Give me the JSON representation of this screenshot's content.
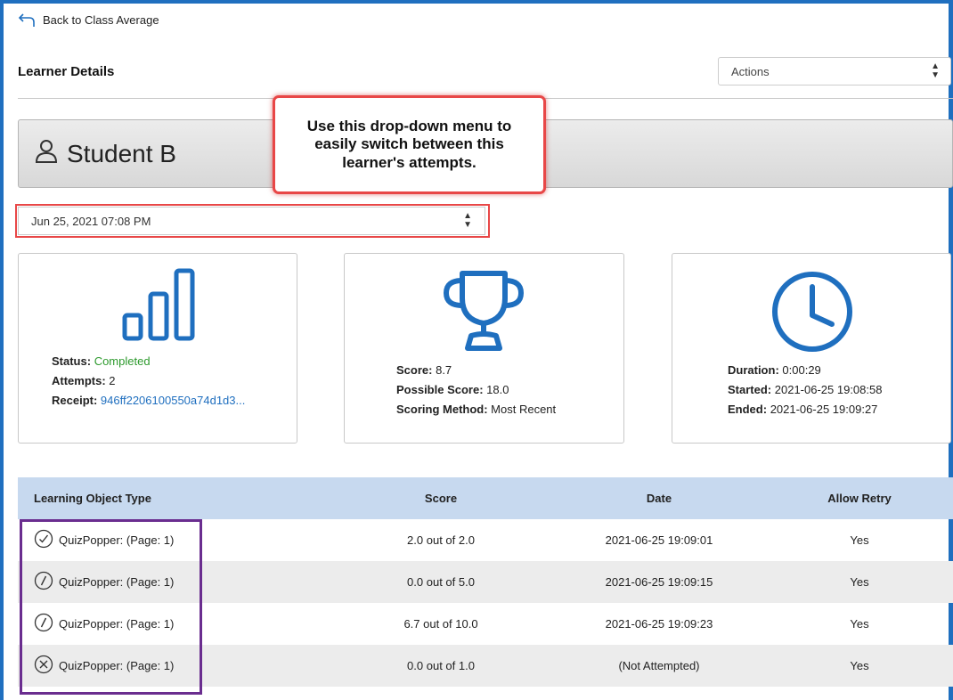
{
  "nav": {
    "back_label": "Back to Class Average"
  },
  "header": {
    "title": "Learner Details",
    "actions_label": "Actions"
  },
  "learner": {
    "name": "Student B"
  },
  "callout": {
    "text": "Use this drop-down menu to easily switch between this learner's attempts."
  },
  "attempt_select": {
    "value": "Jun 25, 2021 07:08 PM"
  },
  "status_card": {
    "status_label": "Status:",
    "status_value": "Completed",
    "attempts_label": "Attempts:",
    "attempts_value": "2",
    "receipt_label": "Receipt:",
    "receipt_value": "946ff2206100550a74d1d3..."
  },
  "score_card": {
    "score_label": "Score:",
    "score_value": "8.7",
    "possible_label": "Possible Score:",
    "possible_value": "18.0",
    "method_label": "Scoring Method:",
    "method_value": "Most Recent"
  },
  "time_card": {
    "duration_label": "Duration:",
    "duration_value": "0:00:29",
    "started_label": "Started:",
    "started_value": "2021-06-25 19:08:58",
    "ended_label": "Ended:",
    "ended_value": "2021-06-25 19:09:27"
  },
  "table": {
    "headers": [
      "Learning Object Type",
      "Score",
      "Date",
      "Allow Retry"
    ],
    "rows": [
      {
        "icon": "check-circle-icon",
        "type": "QuizPopper: (Page: 1)",
        "score": "2.0 out of 2.0",
        "date": "2021-06-25 19:09:01",
        "retry": "Yes"
      },
      {
        "icon": "partial-circle-icon",
        "type": "QuizPopper: (Page: 1)",
        "score": "0.0 out of 5.0",
        "date": "2021-06-25 19:09:15",
        "retry": "Yes"
      },
      {
        "icon": "partial-circle-icon",
        "type": "QuizPopper: (Page: 1)",
        "score": "6.7 out of 10.0",
        "date": "2021-06-25 19:09:23",
        "retry": "Yes"
      },
      {
        "icon": "x-circle-icon",
        "type": "QuizPopper: (Page: 1)",
        "score": "0.0 out of 1.0",
        "date": "(Not Attempted)",
        "retry": "Yes"
      }
    ]
  },
  "colors": {
    "accent": "#1f6fbf",
    "status_green": "#2e9a2e",
    "callout_red": "#e84747",
    "highlight_purple": "#6a2d8f",
    "table_header": "#c7d9ef"
  }
}
